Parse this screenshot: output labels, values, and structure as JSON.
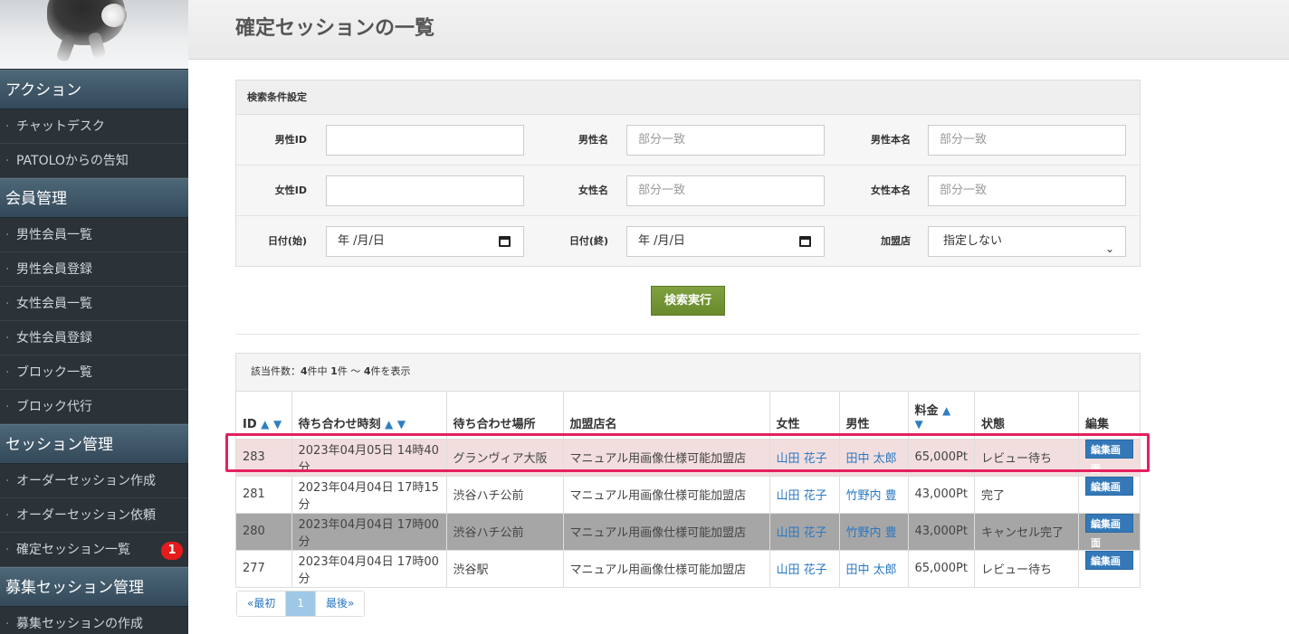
{
  "sidebar": {
    "sections": [
      {
        "header": "アクション",
        "items": [
          "チャットデスク",
          "PATOLOからの告知"
        ]
      },
      {
        "header": "会員管理",
        "items": [
          "男性会員一覧",
          "男性会員登録",
          "女性会員一覧",
          "女性会員登録",
          "ブロック一覧",
          "ブロック代行"
        ]
      },
      {
        "header": "セッション管理",
        "items": [
          "オーダーセッション作成",
          "オーダーセッション依頼",
          "確定セッション一覧"
        ]
      },
      {
        "header": "募集セッション管理",
        "items": [
          "募集セッションの作成"
        ]
      }
    ],
    "badge": "1"
  },
  "page": {
    "title": "確定セッションの一覧"
  },
  "search": {
    "heading": "検索条件設定",
    "labels": {
      "male_id": "男性ID",
      "male_name": "男性名",
      "male_real_name": "男性本名",
      "female_id": "女性ID",
      "female_name": "女性名",
      "female_real_name": "女性本名",
      "date_start": "日付(始)",
      "date_end": "日付(終)",
      "store": "加盟店"
    },
    "placeholder": "部分一致",
    "date_placeholder": "年 /月/日",
    "store_selected": "指定しない",
    "submit": "検索実行"
  },
  "results": {
    "summary_prefix": "該当件数：",
    "total": "4",
    "summary_mid1": "件中 ",
    "from": "1",
    "summary_mid2": "件 ～ ",
    "to": "4",
    "summary_suffix": "件を表示",
    "columns": {
      "id": "ID",
      "time": "待ち合わせ時刻",
      "place": "待ち合わせ場所",
      "store": "加盟店名",
      "female": "女性",
      "male": "男性",
      "price": "料金",
      "status": "状態",
      "edit": "編集"
    },
    "sort_up": "▲",
    "sort_down": "▼",
    "edit_label": "編集画面",
    "rows": [
      {
        "id": "283",
        "time": "2023年04月05日 14時40分",
        "place": "グランヴィア大阪",
        "store": "マニュアル用画像仕様可能加盟店",
        "female": "山田 花子",
        "male": "田中 太郎",
        "price": "65,000Pt",
        "status": "レビュー待ち"
      },
      {
        "id": "281",
        "time": "2023年04月04日 17時15分",
        "place": "渋谷ハチ公前",
        "store": "マニュアル用画像仕様可能加盟店",
        "female": "山田 花子",
        "male": "竹野内 豊",
        "price": "43,000Pt",
        "status": "完了"
      },
      {
        "id": "280",
        "time": "2023年04月04日 17時00分",
        "place": "渋谷ハチ公前",
        "store": "マニュアル用画像仕様可能加盟店",
        "female": "山田 花子",
        "male": "竹野内 豊",
        "price": "43,000Pt",
        "status": "キャンセル完了"
      },
      {
        "id": "277",
        "time": "2023年04月04日 17時00分",
        "place": "渋谷駅",
        "store": "マニュアル用画像仕様可能加盟店",
        "female": "山田 花子",
        "male": "田中 太郎",
        "price": "65,000Pt",
        "status": "レビュー待ち"
      }
    ]
  },
  "pagination": {
    "first": "«最初",
    "current": "1",
    "last": "最後»"
  },
  "colors": {
    "highlight": "#e3215e",
    "badge": "#e51c1c",
    "search_button": "#7fa13f",
    "edit_button": "#3478b7"
  }
}
